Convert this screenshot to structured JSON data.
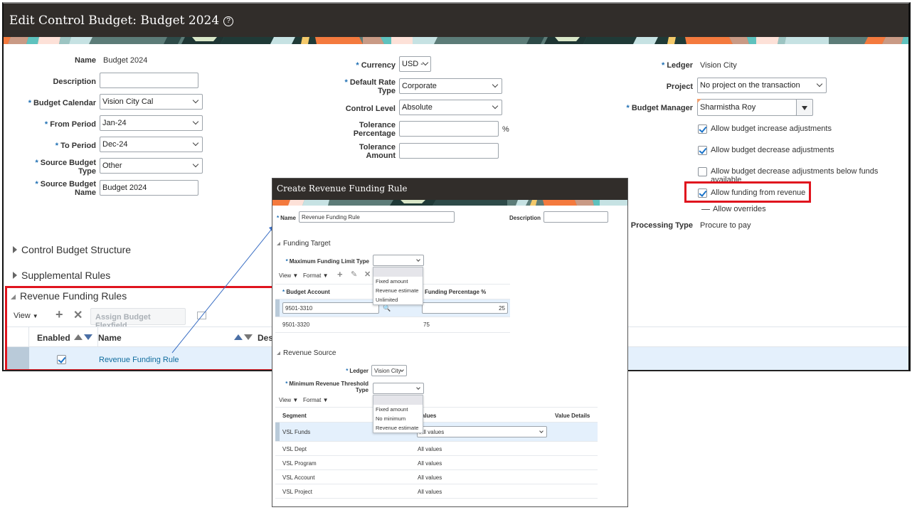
{
  "main": {
    "title": "Edit Control Budget: Budget 2024",
    "help_icon": "?",
    "fields_left": {
      "name_label": "Name",
      "name_value": "Budget 2024",
      "description_label": "Description",
      "description_value": "",
      "budget_calendar_label": "Budget Calendar",
      "budget_calendar_value": "Vision City Cal",
      "from_period_label": "From Period",
      "from_period_value": "Jan-24",
      "to_period_label": "To Period",
      "to_period_value": "Dec-24",
      "source_budget_type_label_1": "Source Budget",
      "source_budget_type_label_2": "Type",
      "source_budget_type_value": "Other",
      "source_budget_name_label_1": "Source Budget",
      "source_budget_name_label_2": "Name",
      "source_budget_name_value": "Budget 2024"
    },
    "fields_middle": {
      "currency_label": "Currency",
      "currency_value": "USD -",
      "default_rate_type_label_1": "Default Rate",
      "default_rate_type_label_2": "Type",
      "default_rate_type_value": "Corporate",
      "control_level_label": "Control Level",
      "control_level_value": "Absolute",
      "tolerance_percentage_label_1": "Tolerance",
      "tolerance_percentage_label_2": "Percentage",
      "tolerance_percentage_value": "",
      "percent_sign": "%",
      "tolerance_amount_label_1": "Tolerance",
      "tolerance_amount_label_2": "Amount",
      "tolerance_amount_value": ""
    },
    "fields_right": {
      "ledger_label": "Ledger",
      "ledger_value": "Vision City",
      "project_label": "Project",
      "project_value": "No project on the transaction",
      "budget_manager_label": "Budget Manager",
      "budget_manager_value": "Sharmistha Roy",
      "checkboxes": [
        {
          "label": "Allow budget increase adjustments",
          "checked": true
        },
        {
          "label": "Allow budget decrease adjustments",
          "checked": true
        },
        {
          "label": "Allow budget decrease adjustments below funds available",
          "checked": false
        },
        {
          "label": "Allow funding from revenue",
          "checked": true
        }
      ],
      "allow_overrides_label": "Allow overrides",
      "processing_type_label": "Processing Type",
      "processing_type_value": "Procure to pay"
    },
    "sections": {
      "control_budget_structure": "Control Budget Structure",
      "supplemental_rules": "Supplemental Rules",
      "revenue_funding_rules": "Revenue Funding Rules"
    },
    "rules_toolbar": {
      "view": "View",
      "assign_budget_flexfield": "Assign Budget Flexfield"
    },
    "rules_table": {
      "columns": [
        "Enabled",
        "Name",
        "Des"
      ],
      "rows": [
        {
          "enabled": true,
          "name": "Revenue Funding Rule"
        }
      ]
    }
  },
  "dialog": {
    "title": "Create Revenue Funding Rule",
    "name_label": "Name",
    "name_value": "Revenue Funding Rule",
    "description_label": "Description",
    "description_value": "",
    "funding_target": {
      "section": "Funding Target",
      "max_limit_type_label": "Maximum Funding Limit Type",
      "max_limit_type_value": "",
      "max_limit_type_options": [
        "",
        "Fixed amount",
        "Revenue estimate",
        "Unlimited"
      ],
      "view": "View",
      "format": "Format",
      "columns": [
        "Budget Account",
        "Funding Percentage %"
      ],
      "rows": [
        {
          "account": "9501-3310",
          "percentage": "25"
        },
        {
          "account": "9501-3320",
          "percentage": "75"
        }
      ]
    },
    "revenue_source": {
      "section": "Revenue Source",
      "ledger_label": "Ledger",
      "ledger_value": "Vision City",
      "min_threshold_label_1": "Minimum Revenue Threshold",
      "min_threshold_label_2": "Type",
      "min_threshold_value": "",
      "min_threshold_options": [
        "",
        "Fixed amount",
        "No minimum",
        "Revenue estimate"
      ],
      "view": "View",
      "format": "Format",
      "columns": [
        "Segment",
        "Values",
        "Value Details"
      ],
      "rows": [
        {
          "segment": "VSL Funds",
          "values": "All values"
        },
        {
          "segment": "VSL Dept",
          "values": "All values"
        },
        {
          "segment": "VSL Program",
          "values": "All values"
        },
        {
          "segment": "VSL Account",
          "values": "All values"
        },
        {
          "segment": "VSL Project",
          "values": "All values"
        }
      ]
    }
  },
  "colors": {
    "header_bg": "#312d2a",
    "highlight_red": "#e0141e",
    "link_blue": "#0f6c9e",
    "selected_row": "#e4f0fc"
  }
}
